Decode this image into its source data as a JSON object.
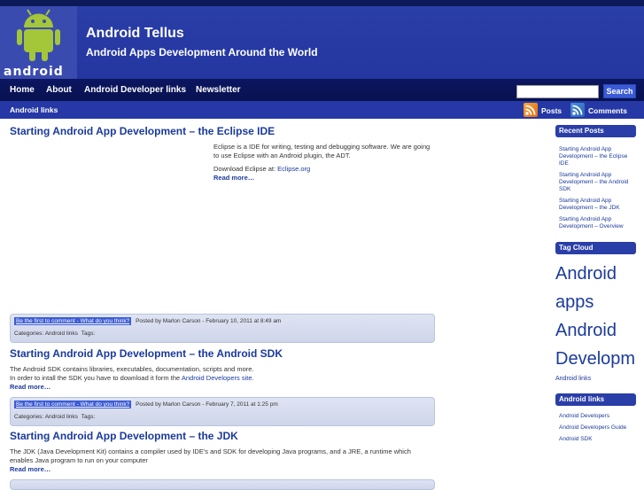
{
  "site": {
    "logo_text": "android",
    "title": "Android Tellus",
    "tagline": "Android Apps Development Around the World"
  },
  "nav": {
    "items": [
      "Home",
      "About",
      "Android Developer links",
      "Newsletter"
    ],
    "search_placeholder": "",
    "search_button": "Search"
  },
  "subnav": {
    "link": "Android links",
    "feeds": [
      {
        "label": "Posts",
        "icon": "rss-icon"
      },
      {
        "label": "Comments",
        "icon": "rss-icon"
      }
    ]
  },
  "posts": [
    {
      "title": "Starting Android App Development – the Eclipse IDE",
      "body1": "Eclipse is a IDE for writing, testing and debugging software. We are going to use Eclipse with an Android plugin, the ADT.",
      "body2_prefix": "Download Eclipse at: ",
      "body2_link": "Eclipse.org",
      "read_more": "Read more…",
      "comment_link": "Be the first to comment",
      "comment_suffix": " - What do you think?",
      "posted": "Posted by Marlon Carson - February 10, 2011 at 8:49 am",
      "categories_label": "Categories:",
      "category": "Android links",
      "tags_label": "Tags:"
    },
    {
      "title": "Starting Android App Development – the Android SDK",
      "body1": "The Android SDK contains libraries, executables, documentation, scripts and more.",
      "body2_prefix": "In order to intall the SDK you have to download it form the ",
      "body2_link": "Android Developers site",
      "body2_suffix": ".",
      "read_more": "Read more…",
      "comment_link": "Be the first to comment",
      "comment_suffix": " - What do you think?",
      "posted": "Posted by Marlon Carson - February 7, 2011 at 1:25 pm",
      "categories_label": "Categories:",
      "category": "Android links",
      "tags_label": "Tags:"
    },
    {
      "title": "Starting Android App Development – the JDK",
      "body1": "The JDK (Java Development Kit) contains a compiler used by IDE's and SDK for developing Java programs, and a JRE, a runtime which enables Java program to run on your computer",
      "read_more": "Read more…"
    }
  ],
  "sidebar": {
    "recent_title": "Recent Posts",
    "recent": [
      "Starting Android App Development – the Eclipse IDE",
      "Starting Android App Development – the Android SDK",
      "Starting Android App Development – the JDK",
      "Starting Android App Development – Overview"
    ],
    "tagcloud_title": "Tag Cloud",
    "tags_big": [
      "Android",
      "apps",
      "Android",
      "Developm"
    ],
    "tags_small": "Android links",
    "links_title": "Android links",
    "links": [
      "Android Developers",
      "Android Developers Guide",
      "Android SDK"
    ]
  },
  "colors": {
    "header": "#2436a0",
    "nav": "#081250",
    "link": "#1b3a9c",
    "rss": "#e36e0e"
  }
}
